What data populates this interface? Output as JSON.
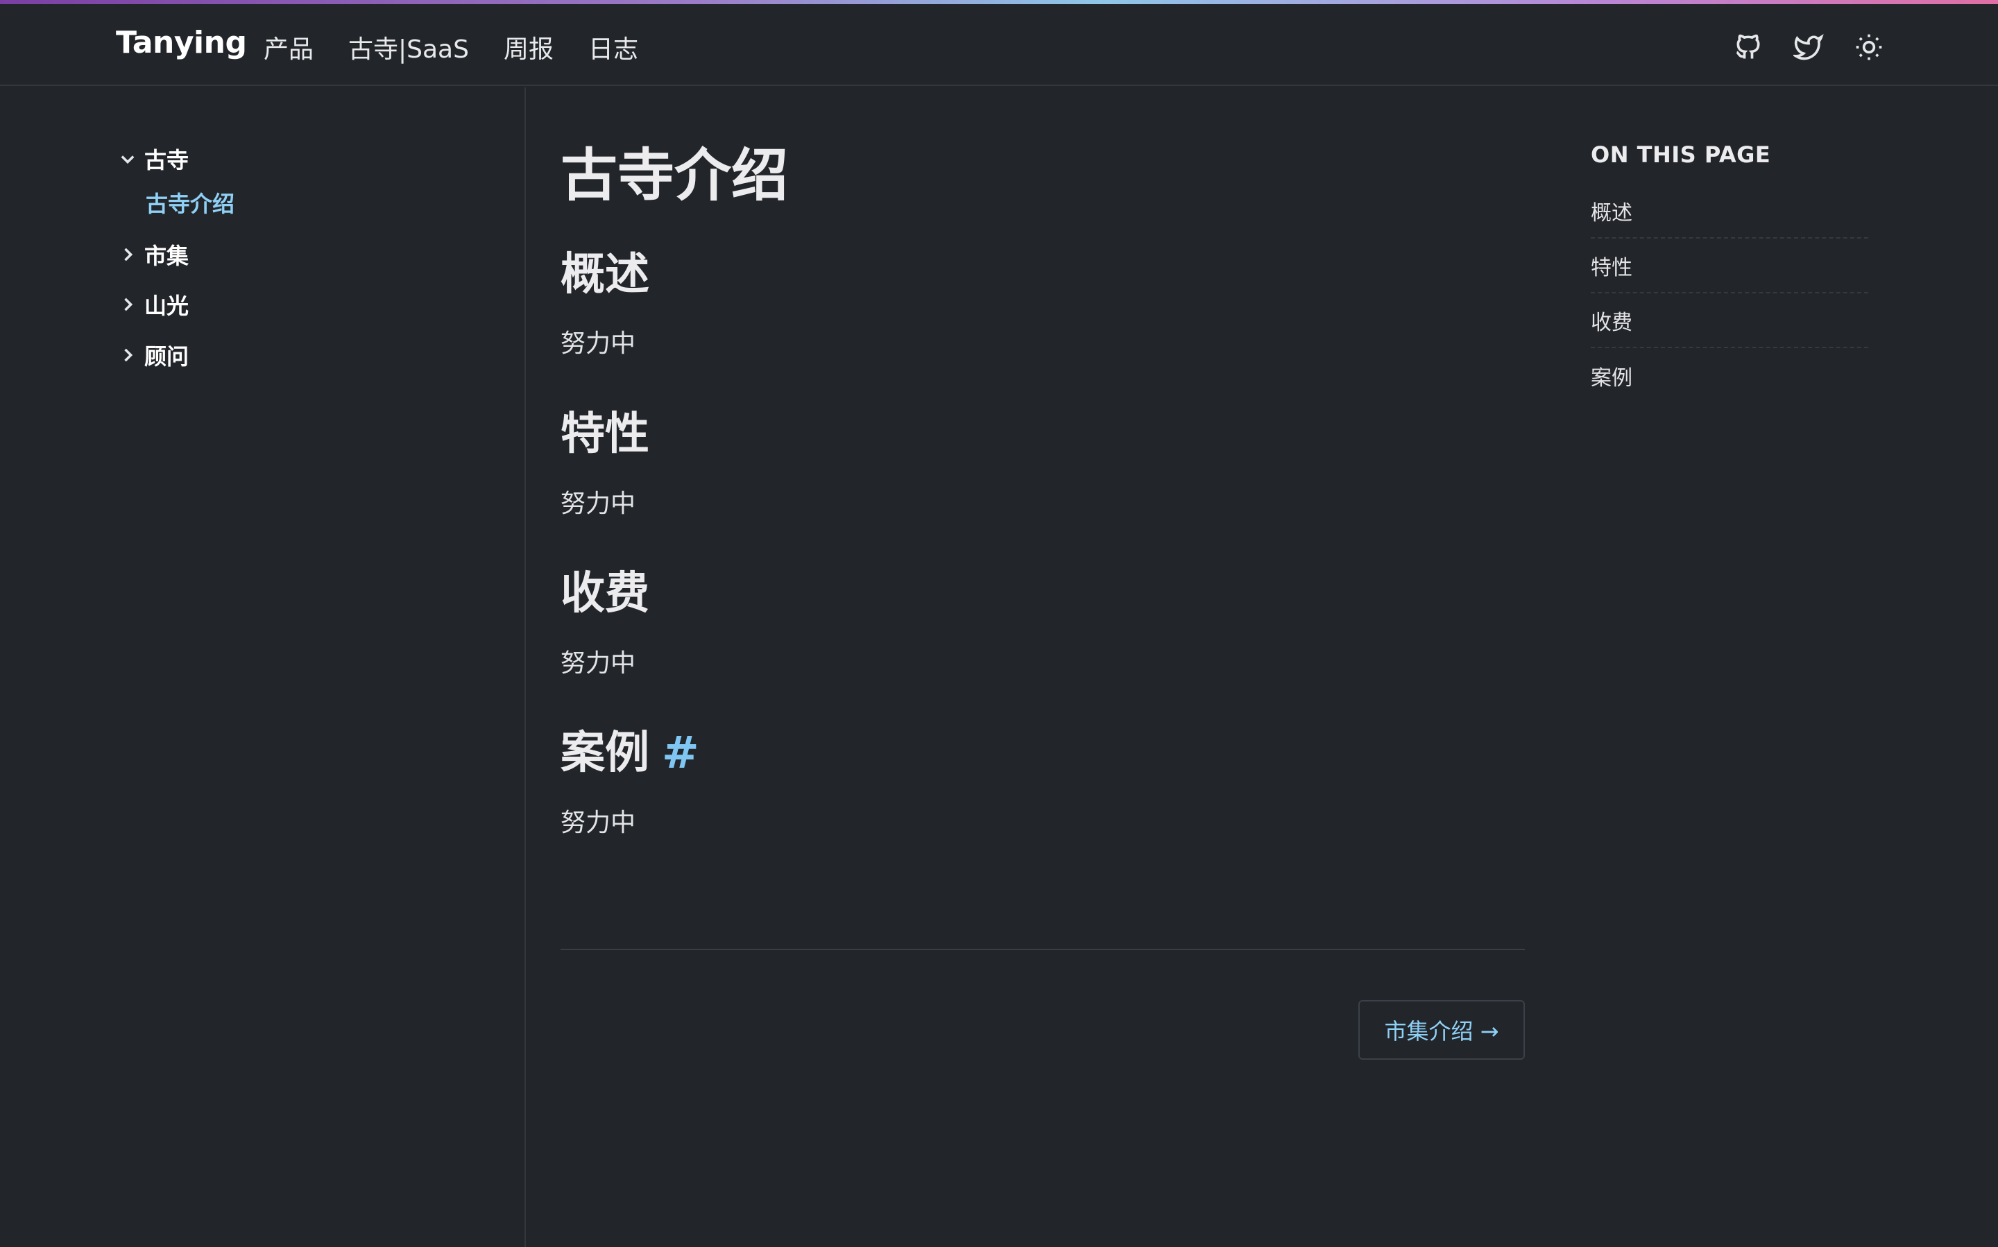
{
  "header": {
    "brand": "Tanying",
    "nav": [
      "产品",
      "古寺|SaaS",
      "周报",
      "日志"
    ],
    "icons": [
      "github-icon",
      "twitter-icon",
      "sun-icon"
    ]
  },
  "sidebar": {
    "groups": [
      {
        "label": "古寺",
        "expanded": true,
        "children": [
          "古寺介绍"
        ]
      },
      {
        "label": "市集",
        "expanded": false
      },
      {
        "label": "山光",
        "expanded": false
      },
      {
        "label": "顾问",
        "expanded": false
      }
    ]
  },
  "main": {
    "title": "古寺介绍",
    "sections": [
      {
        "heading": "概述",
        "body": "努力中"
      },
      {
        "heading": "特性",
        "body": "努力中"
      },
      {
        "heading": "收费",
        "body": "努力中"
      },
      {
        "heading": "案例",
        "anchor": "#",
        "body": "努力中"
      }
    ],
    "next_link": "市集介绍 →"
  },
  "toc": {
    "title": "ON THIS PAGE",
    "items": [
      "概述",
      "特性",
      "收费",
      "案例"
    ]
  },
  "colors": {
    "background": "#22252a",
    "accent": "#8fd0f5",
    "border": "#33373e"
  }
}
